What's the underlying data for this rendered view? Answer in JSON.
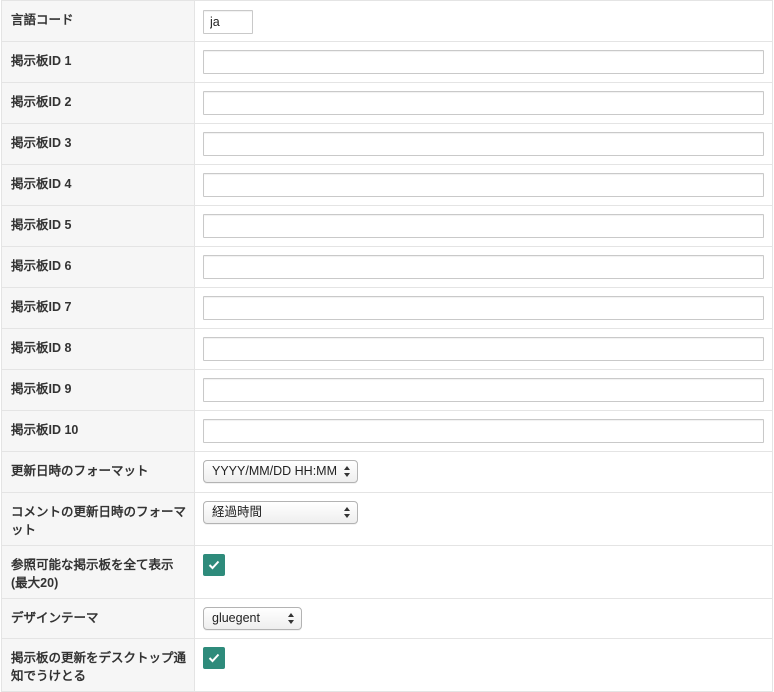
{
  "settings": {
    "lang": {
      "label": "言語コード",
      "value": "ja"
    },
    "boards": [
      {
        "label": "掲示板ID 1",
        "value": ""
      },
      {
        "label": "掲示板ID 2",
        "value": ""
      },
      {
        "label": "掲示板ID 3",
        "value": ""
      },
      {
        "label": "掲示板ID 4",
        "value": ""
      },
      {
        "label": "掲示板ID 5",
        "value": ""
      },
      {
        "label": "掲示板ID 6",
        "value": ""
      },
      {
        "label": "掲示板ID 7",
        "value": ""
      },
      {
        "label": "掲示板ID 8",
        "value": ""
      },
      {
        "label": "掲示板ID 9",
        "value": ""
      },
      {
        "label": "掲示板ID 10",
        "value": ""
      }
    ],
    "date_format": {
      "label": "更新日時のフォーマット",
      "selected": "YYYY/MM/DD HH:MM"
    },
    "comment_date_format": {
      "label": "コメントの更新日時のフォーマット",
      "selected": "経過時間"
    },
    "show_all_boards": {
      "label": "参照可能な掲示板を全て表示(最大20)",
      "checked": true
    },
    "design_theme": {
      "label": "デザインテーマ",
      "selected": "gluegent"
    },
    "desktop_notify": {
      "label": "掲示板の更新をデスクトップ通知でうけとる",
      "checked": true
    }
  },
  "colors": {
    "checkbox": "#2e8b7b",
    "label_bg": "#f6f6f6",
    "border": "#e4e4e4"
  }
}
